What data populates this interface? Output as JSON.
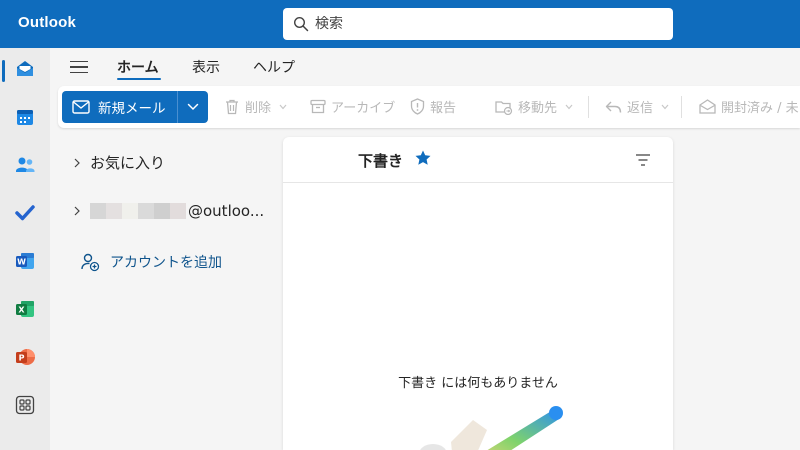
{
  "app": {
    "title": "Outlook",
    "brand_color": "#0f6cbd"
  },
  "search": {
    "placeholder": "検索"
  },
  "rail": {
    "items": [
      {
        "name": "mail",
        "active": true
      },
      {
        "name": "calendar"
      },
      {
        "name": "people"
      },
      {
        "name": "todo"
      },
      {
        "name": "word"
      },
      {
        "name": "excel"
      },
      {
        "name": "powerpoint"
      },
      {
        "name": "more-apps"
      }
    ]
  },
  "menu": {
    "tabs": [
      {
        "label": "ホーム",
        "active": true
      },
      {
        "label": "表示"
      },
      {
        "label": "ヘルプ"
      }
    ]
  },
  "toolbar": {
    "new_mail_label": "新規メール",
    "delete_label": "削除",
    "archive_label": "アーカイブ",
    "report_label": "報告",
    "move_label": "移動先",
    "reply_label": "返信",
    "mark_read_label": "開封済み / 未"
  },
  "folders": {
    "favorites_label": "お気に入り",
    "account_suffix": "@outloo...",
    "add_account_label": "アカウントを追加"
  },
  "message_list": {
    "title": "下書き",
    "empty_text": "下書き には何もありません"
  }
}
